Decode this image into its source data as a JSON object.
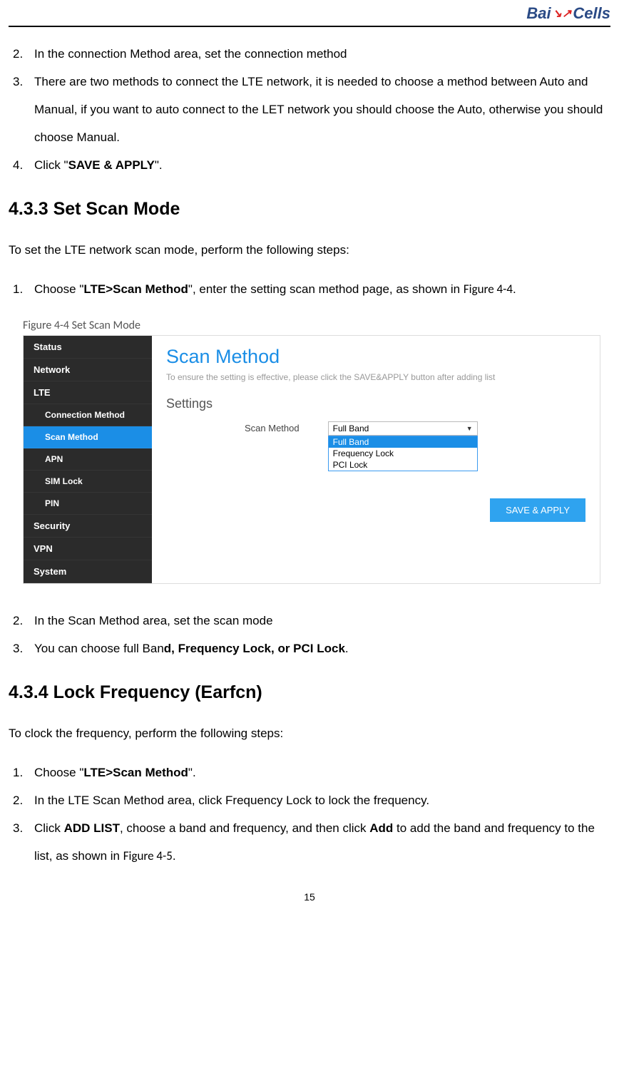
{
  "logo": {
    "text1": "Bai",
    "text2": "Cells"
  },
  "topList": {
    "item2": "In the connection Method area, set the connection method",
    "item3": "There are two methods to connect the LTE network, it is needed to choose a method between Auto and Manual, if you want to auto connect to the LET network you should choose the Auto, otherwise you should choose Manual.",
    "item4_pre": "Click \"",
    "item4_bold": "SAVE & APPLY",
    "item4_post": "\"."
  },
  "section433": {
    "heading_num": "4.3.3",
    "heading_text": "Set Scan Mode",
    "intro": "To set the LTE network scan mode, perform the following steps:",
    "step1_pre": "Choose \"",
    "step1_bold": "LTE>Scan Method",
    "step1_mid": "\", enter the setting scan method page, as shown in ",
    "step1_fig": "Figure 4-4",
    "step1_post": ".",
    "figcaption": "Figure 4-4 Set Scan Mode",
    "step2": "In the Scan Method area, set the scan mode",
    "step3_pre": "You can choose full Ban",
    "step3_bold": "d, Frequency Lock, or PCI Lock",
    "step3_post": "."
  },
  "screenshot": {
    "sidebar": {
      "status": "Status",
      "network": "Network",
      "lte": "LTE",
      "connMethod": "Connection Method",
      "scanMethod": "Scan Method",
      "apn": "APN",
      "simLock": "SIM Lock",
      "pin": "PIN",
      "security": "Security",
      "vpn": "VPN",
      "system": "System"
    },
    "panel": {
      "title": "Scan Method",
      "hint": "To ensure the setting is effective, please click the SAVE&APPLY button after adding list",
      "settings": "Settings",
      "label": "Scan Method",
      "selected": "Full Band",
      "opt1": "Full Band",
      "opt2": "Frequency Lock",
      "opt3": "PCI Lock",
      "saveBtn": "SAVE & APPLY"
    }
  },
  "section434": {
    "heading_num": "4.3.4",
    "heading_text": "Lock Frequency (Earfcn)",
    "intro": "To clock the frequency, perform the following steps:",
    "step1_pre": "Choose \"",
    "step1_bold": "LTE>Scan Method",
    "step1_post": "\".",
    "step2": "In the LTE Scan Method area, click Frequency Lock to lock the frequency.",
    "step3_pre": "Click ",
    "step3_bold1": "ADD LIST",
    "step3_mid1": ", choose a band and frequency, and then click ",
    "step3_bold2": "Add",
    "step3_mid2": " to add the band and frequency to the list, as shown in ",
    "step3_fig": "Figure 4-5",
    "step3_post": "."
  },
  "pageNumber": "15"
}
